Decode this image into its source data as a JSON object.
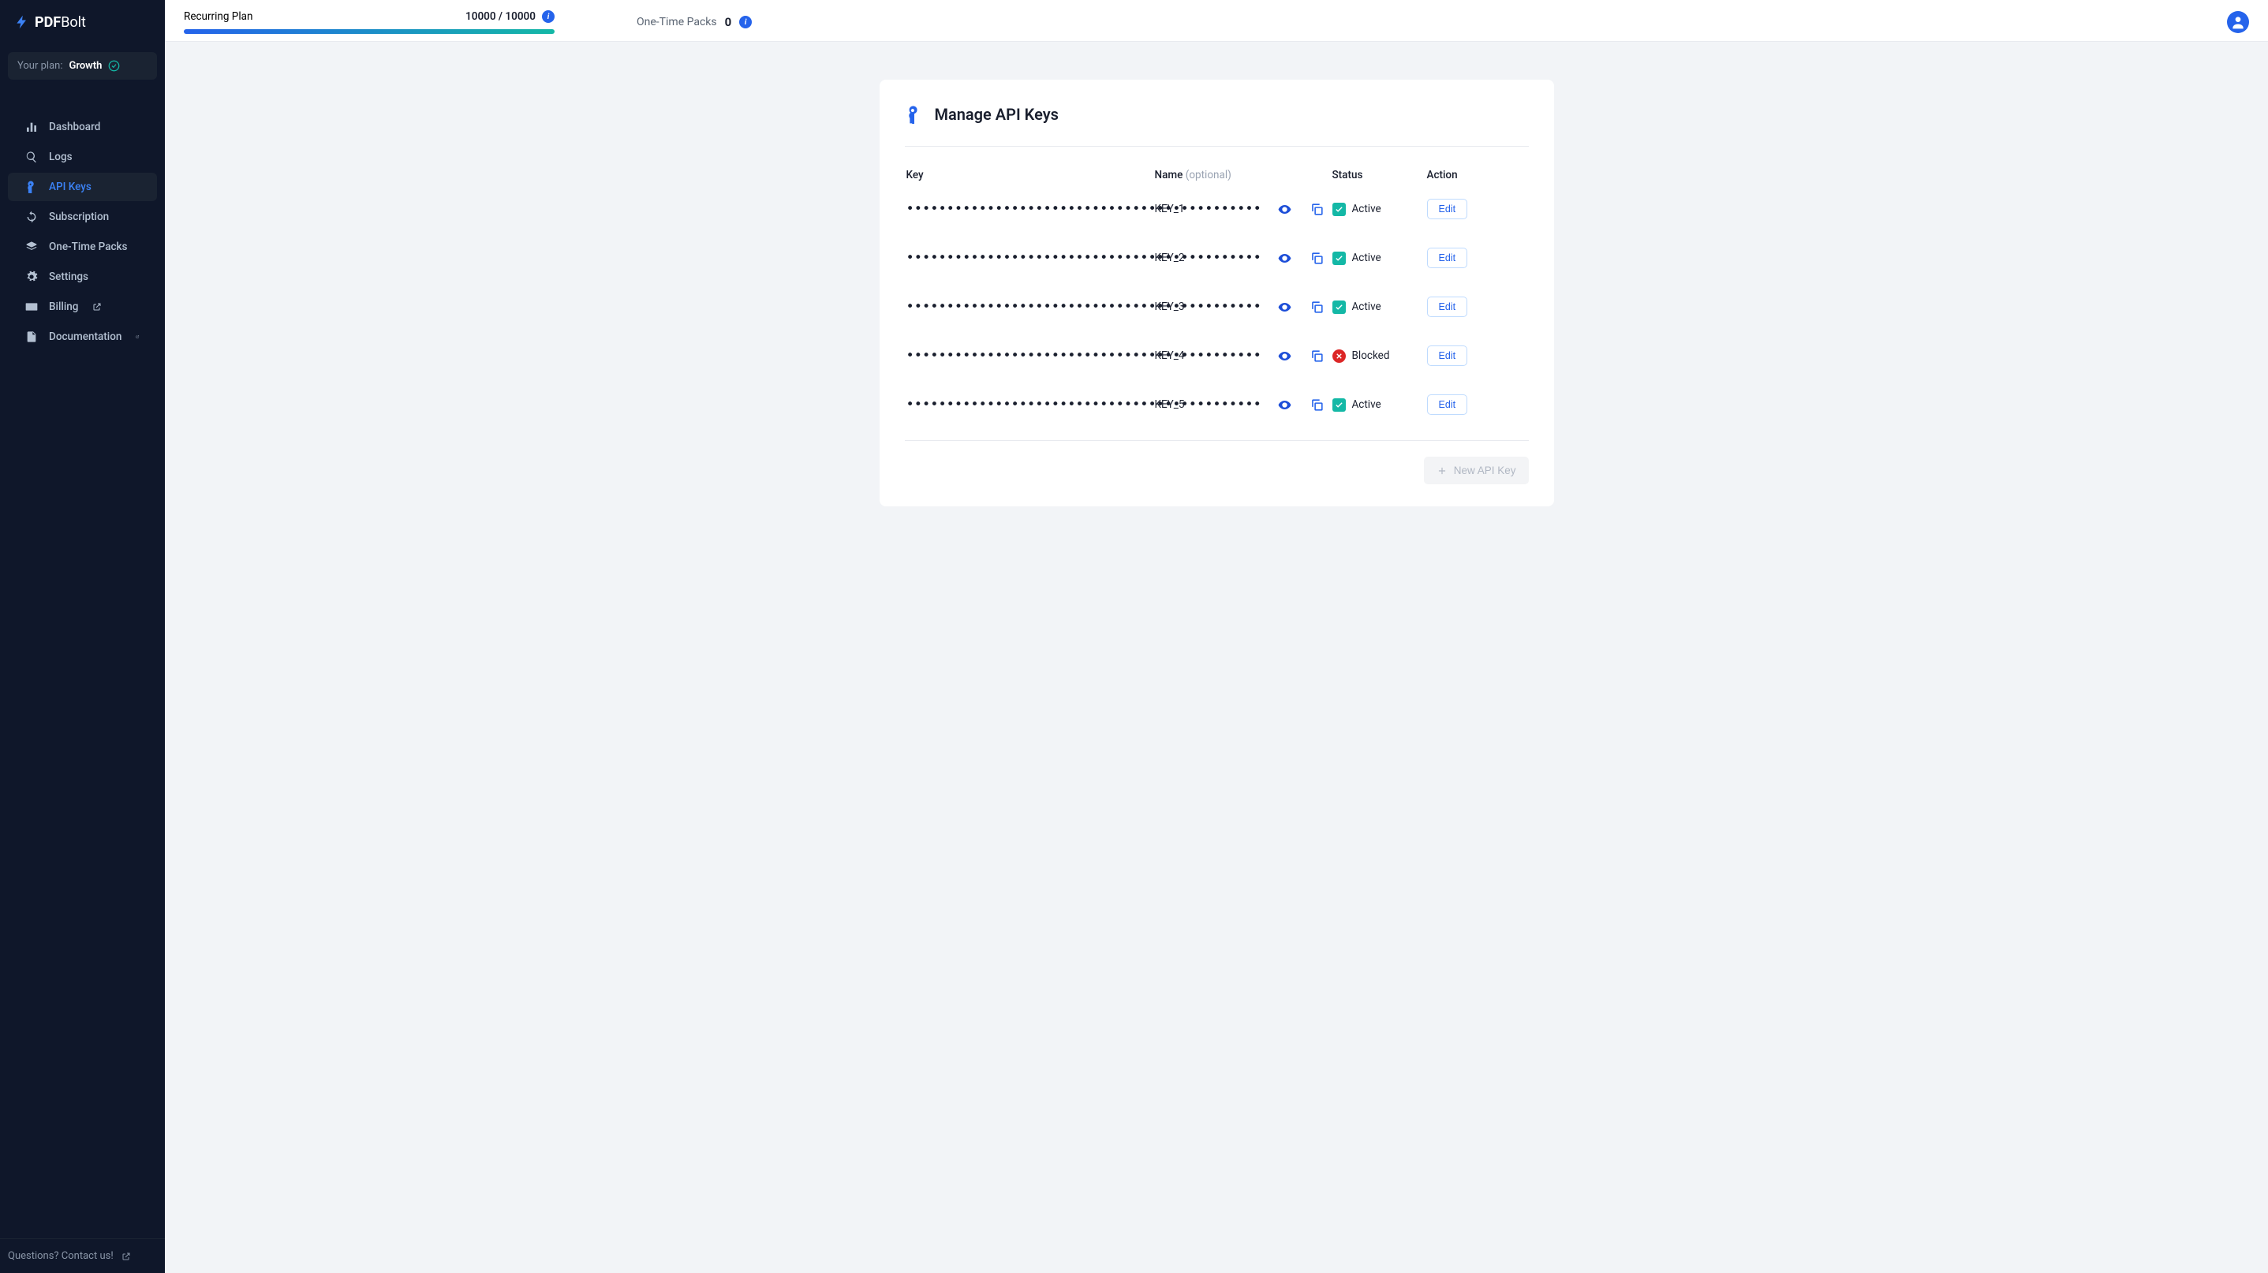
{
  "brand": {
    "part1": "PDF",
    "part2": "Bolt"
  },
  "sidebar": {
    "plan_label": "Your plan:",
    "plan_name": "Growth",
    "items": [
      {
        "label": "Dashboard",
        "icon": "bar-chart"
      },
      {
        "label": "Logs",
        "icon": "search"
      },
      {
        "label": "API Keys",
        "icon": "key",
        "active": true
      },
      {
        "label": "Subscription",
        "icon": "refresh"
      },
      {
        "label": "One-Time Packs",
        "icon": "layers"
      },
      {
        "label": "Settings",
        "icon": "gear"
      },
      {
        "label": "Billing",
        "icon": "credit-card",
        "external": true
      },
      {
        "label": "Documentation",
        "icon": "document",
        "external": true
      }
    ],
    "footer": "Questions? Contact us!"
  },
  "topbar": {
    "plan_label": "Recurring Plan",
    "usage_text": "10000 / 10000",
    "packs_label": "One-Time Packs",
    "packs_value": "0"
  },
  "page": {
    "title": "Manage API Keys",
    "columns": {
      "key": "Key",
      "name": "Name",
      "name_optional": "(optional)",
      "status": "Status",
      "action": "Action"
    },
    "key_mask": "••••••••••••••••••••••••••••••••••••••••••••",
    "status_active": "Active",
    "status_blocked": "Blocked",
    "edit_label": "Edit",
    "new_key_label": "New API Key",
    "rows": [
      {
        "name": "KEY_1",
        "status": "active"
      },
      {
        "name": "KEY_2",
        "status": "active"
      },
      {
        "name": "KEY_3",
        "status": "active"
      },
      {
        "name": "KEY_4",
        "status": "blocked"
      },
      {
        "name": "KEY_5",
        "status": "active"
      }
    ]
  }
}
